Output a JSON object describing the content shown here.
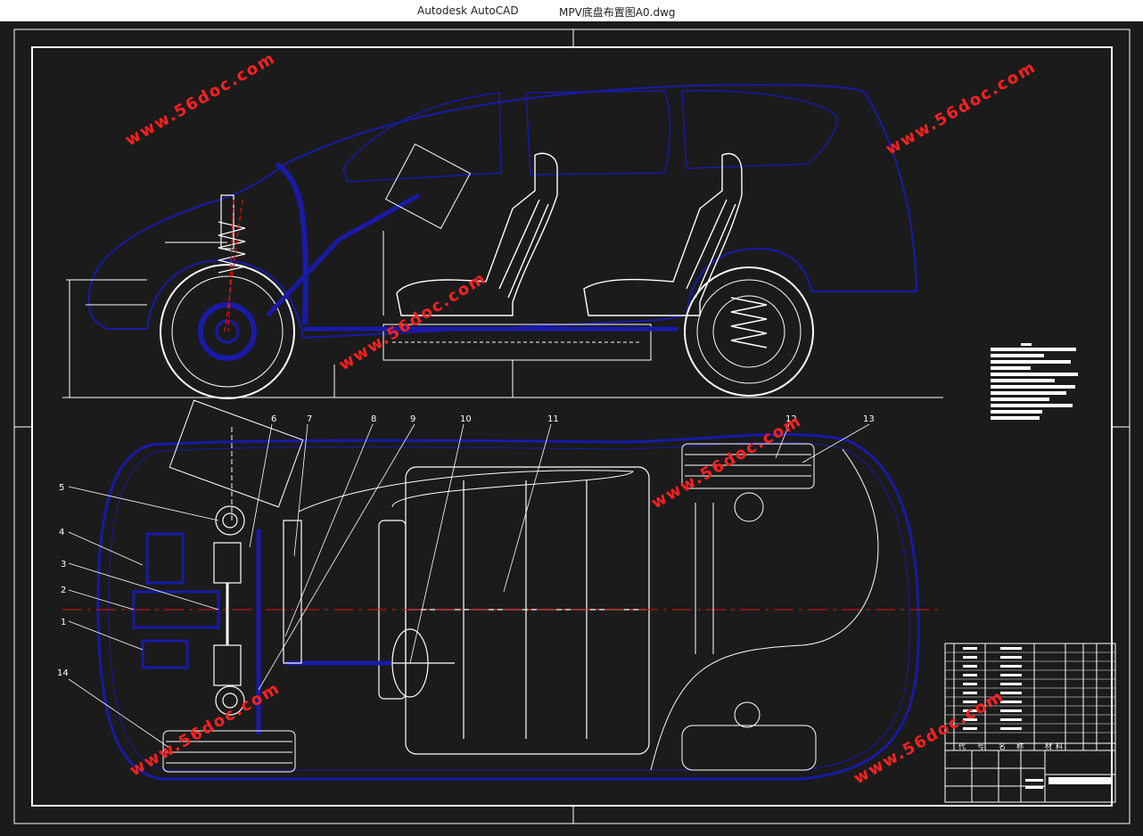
{
  "window": {
    "app_name": "Autodesk AutoCAD",
    "file_name": "MPV底盘布置图A0.dwg"
  },
  "drawing": {
    "balloons": [
      "1",
      "2",
      "3",
      "4",
      "5",
      "6",
      "7",
      "8",
      "9",
      "10",
      "11",
      "12",
      "13",
      "14"
    ],
    "watermark": "www.56doc.com",
    "title_block": {
      "header_labels": [
        "代",
        "号",
        "名",
        "称",
        "材",
        "料"
      ]
    }
  },
  "colors": {
    "background": "#1b1b1b",
    "body_outline": "#1a1aa8",
    "line_white": "#ffffff",
    "centerline_red": "#e01010",
    "watermark_red": "#ff2020"
  }
}
